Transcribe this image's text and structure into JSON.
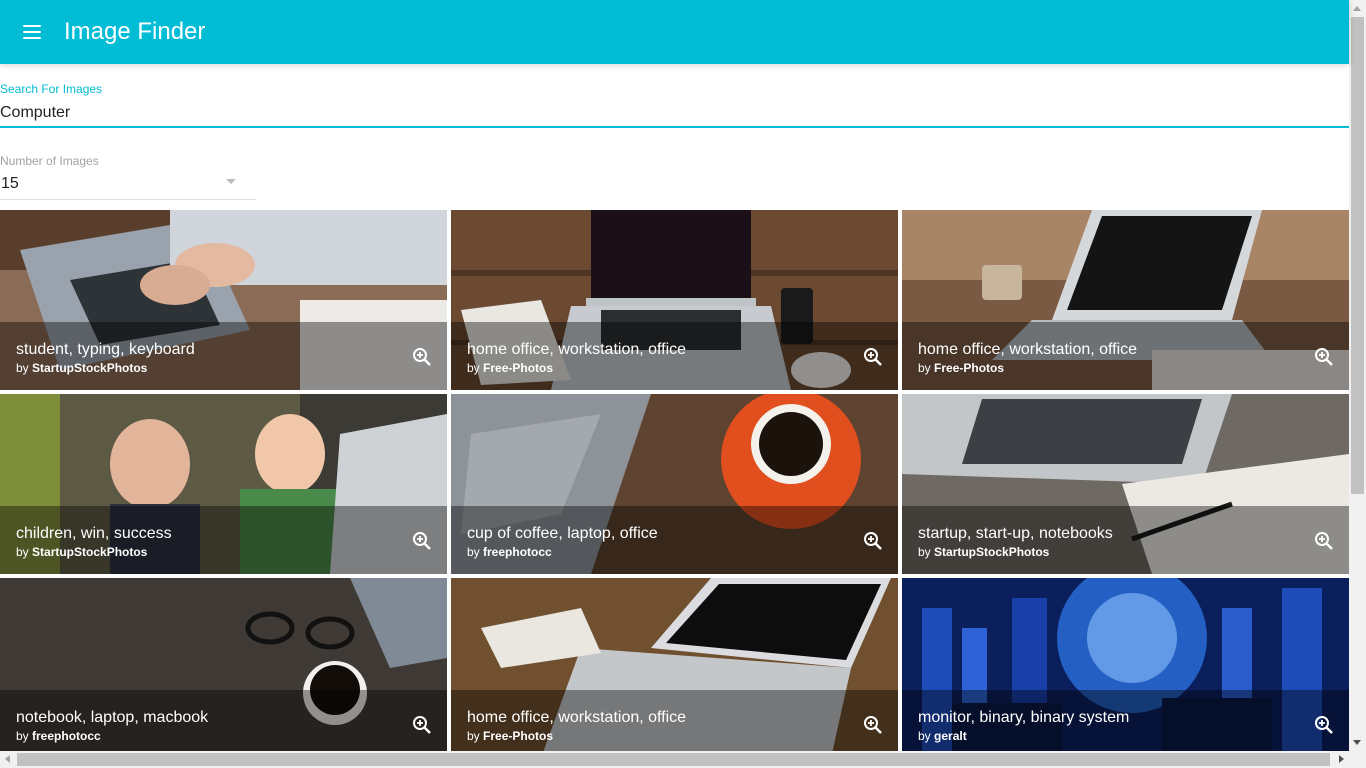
{
  "appbar": {
    "title": "Image Finder",
    "color": "#00bcd4"
  },
  "search": {
    "label": "Search For Images",
    "value": "Computer"
  },
  "count": {
    "label": "Number of Images",
    "value": "15"
  },
  "tiles": [
    {
      "title": "student, typing, keyboard",
      "by": "by ",
      "author": "StartupStockPhotos"
    },
    {
      "title": "home office, workstation, office",
      "by": "by ",
      "author": "Free-Photos"
    },
    {
      "title": "home office, workstation, office",
      "by": "by ",
      "author": "Free-Photos"
    },
    {
      "title": "children, win, success",
      "by": "by ",
      "author": "StartupStockPhotos"
    },
    {
      "title": "cup of coffee, laptop, office",
      "by": "by ",
      "author": "freephotocc"
    },
    {
      "title": "startup, start-up, notebooks",
      "by": "by ",
      "author": "StartupStockPhotos"
    },
    {
      "title": "notebook, laptop, macbook",
      "by": "by ",
      "author": "freephotocc"
    },
    {
      "title": "home office, workstation, office",
      "by": "by ",
      "author": "Free-Photos"
    },
    {
      "title": "monitor, binary, binary system",
      "by": "by ",
      "author": "geralt"
    }
  ],
  "icons": {
    "menu": "menu-icon",
    "zoom": "zoom-in-icon",
    "dropdown": "chevron-down-icon"
  }
}
